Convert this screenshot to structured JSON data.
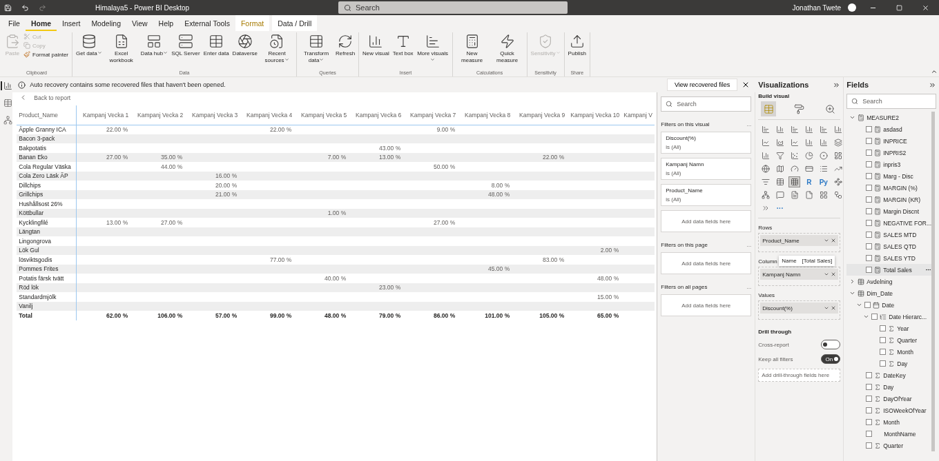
{
  "window": {
    "title": "Himalaya5 - Power BI Desktop",
    "search_placeholder": "Search",
    "user": "Jonathan Twete"
  },
  "ribbon_tabs": [
    {
      "label": "File",
      "kind": "plain",
      "selected": false
    },
    {
      "label": "Home",
      "kind": "plain",
      "selected": true
    },
    {
      "label": "Insert",
      "kind": "plain",
      "selected": false
    },
    {
      "label": "Modeling",
      "kind": "plain",
      "selected": false
    },
    {
      "label": "View",
      "kind": "plain",
      "selected": false
    },
    {
      "label": "Help",
      "kind": "plain",
      "selected": false
    },
    {
      "label": "External Tools",
      "kind": "plain",
      "selected": false
    },
    {
      "label": "Format",
      "kind": "contextual",
      "selected": false
    },
    {
      "label": "Data / Drill",
      "kind": "contextual",
      "selected": false
    }
  ],
  "ribbon_groups": [
    {
      "label": "Clipboard",
      "buttons": [
        {
          "label": "Paste",
          "kind": "large",
          "disabled": true,
          "dropdown": false
        },
        {
          "label": "Cut",
          "kind": "small",
          "disabled": true,
          "dropdown": false
        },
        {
          "label": "Copy",
          "kind": "small",
          "disabled": true,
          "dropdown": false
        },
        {
          "label": "Format painter",
          "kind": "small",
          "disabled": false,
          "dropdown": false
        }
      ]
    },
    {
      "label": "Data",
      "buttons": [
        {
          "label": "Get data",
          "kind": "large",
          "disabled": false,
          "dropdown": true
        },
        {
          "label": "Excel workbook",
          "kind": "large",
          "disabled": false,
          "dropdown": false
        },
        {
          "label": "Data hub",
          "kind": "large",
          "disabled": false,
          "dropdown": true
        },
        {
          "label": "SQL Server",
          "kind": "large",
          "disabled": false,
          "dropdown": false
        },
        {
          "label": "Enter data",
          "kind": "large",
          "disabled": false,
          "dropdown": false
        },
        {
          "label": "Dataverse",
          "kind": "large",
          "disabled": false,
          "dropdown": false
        },
        {
          "label": "Recent sources",
          "kind": "large",
          "disabled": false,
          "dropdown": true
        }
      ]
    },
    {
      "label": "Queries",
      "buttons": [
        {
          "label": "Transform data",
          "kind": "large",
          "disabled": false,
          "dropdown": true
        },
        {
          "label": "Refresh",
          "kind": "large",
          "disabled": false,
          "dropdown": false
        }
      ]
    },
    {
      "label": "Insert",
      "buttons": [
        {
          "label": "New visual",
          "kind": "large",
          "disabled": false,
          "dropdown": false
        },
        {
          "label": "Text box",
          "kind": "large",
          "disabled": false,
          "dropdown": false
        },
        {
          "label": "More visuals",
          "kind": "large",
          "disabled": false,
          "dropdown": true
        }
      ]
    },
    {
      "label": "Calculations",
      "buttons": [
        {
          "label": "New measure",
          "kind": "large",
          "disabled": false,
          "dropdown": false
        },
        {
          "label": "Quick measure",
          "kind": "large",
          "disabled": false,
          "dropdown": false
        }
      ]
    },
    {
      "label": "Sensitivity",
      "buttons": [
        {
          "label": "Sensitivity",
          "kind": "large",
          "disabled": true,
          "dropdown": true
        }
      ]
    },
    {
      "label": "Share",
      "buttons": [
        {
          "label": "Publish",
          "kind": "large",
          "disabled": false,
          "dropdown": false
        }
      ]
    }
  ],
  "view_rail": [
    {
      "selected": true
    },
    {
      "selected": false
    },
    {
      "selected": false
    }
  ],
  "notification": {
    "message": "Auto recovery contains some recovered files that haven't been opened.",
    "button": "View recovered files"
  },
  "back_link": "Back to report",
  "matrix": {
    "row_header": "Product_Name",
    "columns": [
      "Kampanj Vecka 1",
      "Kampanj Vecka 2",
      "Kampanj Vecka 3",
      "Kampanj Vecka 4",
      "Kampanj Vecka 5",
      "Kampanj Vecka 6",
      "Kampanj Vecka 7",
      "Kampanj Vecka 8",
      "Kampanj Vecka 9",
      "Kampanj Vecka 10",
      "Kampanj V"
    ],
    "rows": [
      {
        "name": "Äpple Granny ICA",
        "cells": [
          "22.00 %",
          null,
          null,
          "22.00 %",
          null,
          null,
          "9.00 %",
          null,
          null,
          null,
          null
        ]
      },
      {
        "name": "Bacon 3-pack",
        "cells": [
          null,
          null,
          null,
          null,
          null,
          null,
          null,
          null,
          null,
          null,
          null
        ]
      },
      {
        "name": "Bakpotatis",
        "cells": [
          null,
          null,
          null,
          null,
          null,
          "43.00 %",
          null,
          null,
          null,
          null,
          null
        ]
      },
      {
        "name": "Banan Eko",
        "cells": [
          "27.00 %",
          "35.00 %",
          null,
          null,
          "7.00 %",
          "13.00 %",
          null,
          null,
          "22.00 %",
          null,
          null
        ]
      },
      {
        "name": "Cola Regular Väska",
        "cells": [
          null,
          "44.00 %",
          null,
          null,
          null,
          null,
          "50.00 %",
          null,
          null,
          null,
          null
        ]
      },
      {
        "name": "Cola Zero Läsk ÄP",
        "cells": [
          null,
          null,
          "16.00 %",
          null,
          null,
          null,
          null,
          null,
          null,
          null,
          null
        ]
      },
      {
        "name": "Dillchips",
        "cells": [
          null,
          null,
          "20.00 %",
          null,
          null,
          null,
          null,
          "8.00 %",
          null,
          null,
          null
        ]
      },
      {
        "name": "Grillchips",
        "cells": [
          null,
          null,
          "21.00 %",
          null,
          null,
          null,
          null,
          "48.00 %",
          null,
          null,
          null
        ]
      },
      {
        "name": "Hushållsost 26%",
        "cells": [
          null,
          null,
          null,
          null,
          null,
          null,
          null,
          null,
          null,
          null,
          null
        ]
      },
      {
        "name": "Köttbullar",
        "cells": [
          null,
          null,
          null,
          null,
          "1.00 %",
          null,
          null,
          null,
          null,
          null,
          null
        ]
      },
      {
        "name": "Kycklingfilé",
        "cells": [
          "13.00 %",
          "27.00 %",
          null,
          null,
          null,
          null,
          "27.00 %",
          null,
          null,
          null,
          null
        ]
      },
      {
        "name": "Längtan",
        "cells": [
          null,
          null,
          null,
          null,
          null,
          null,
          null,
          null,
          null,
          null,
          null
        ]
      },
      {
        "name": "Lingongrova",
        "cells": [
          null,
          null,
          null,
          null,
          null,
          null,
          null,
          null,
          null,
          null,
          null
        ]
      },
      {
        "name": "Lök Gul",
        "cells": [
          null,
          null,
          null,
          null,
          null,
          null,
          null,
          null,
          null,
          "2.00 %",
          null
        ]
      },
      {
        "name": "lösviktsgodis",
        "cells": [
          null,
          null,
          null,
          "77.00 %",
          null,
          null,
          null,
          null,
          "83.00 %",
          null,
          null
        ]
      },
      {
        "name": "Pommes Frites",
        "cells": [
          null,
          null,
          null,
          null,
          null,
          null,
          null,
          "45.00 %",
          null,
          null,
          null
        ]
      },
      {
        "name": "Potatis färsk tvätt",
        "cells": [
          null,
          null,
          null,
          null,
          "40.00 %",
          null,
          null,
          null,
          null,
          "48.00 %",
          null
        ]
      },
      {
        "name": "Röd lök",
        "cells": [
          null,
          null,
          null,
          null,
          null,
          "23.00 %",
          null,
          null,
          null,
          null,
          null
        ]
      },
      {
        "name": "Standardmjölk",
        "cells": [
          null,
          null,
          null,
          null,
          null,
          null,
          null,
          null,
          null,
          "15.00 %",
          null
        ]
      },
      {
        "name": "Vanilj",
        "cells": [
          null,
          null,
          null,
          null,
          null,
          null,
          null,
          null,
          null,
          null,
          null
        ]
      }
    ],
    "total": {
      "name": "Total",
      "cells": [
        "62.00 %",
        "106.00 %",
        "57.00 %",
        "99.00 %",
        "48.00 %",
        "79.00 %",
        "86.00 %",
        "101.00 %",
        "105.00 %",
        "65.00 %",
        null
      ]
    }
  },
  "filters": {
    "search_placeholder": "Search",
    "sections": [
      {
        "title": "Filters on this visual",
        "more": "...",
        "cards": [
          {
            "name": "Discount(%)",
            "state": "is (All)"
          },
          {
            "name": "Kampanj Namn",
            "state": "is (All)"
          },
          {
            "name": "Product_Name",
            "state": "is (All)"
          }
        ],
        "add": "Add data fields here"
      },
      {
        "title": "Filters on this page",
        "more": "...",
        "add": "Add data fields here"
      },
      {
        "title": "Filters on all pages",
        "more": "...",
        "add": "Add data fields here"
      }
    ]
  },
  "visualizations": {
    "title": "Visualizations",
    "subtitle": "Build visual",
    "tabs": [
      {
        "selected": true
      },
      {
        "selected": false
      },
      {
        "selected": false
      }
    ],
    "gallery": [
      {
        "kind": "icon",
        "selected": false
      },
      {
        "kind": "icon",
        "selected": false
      },
      {
        "kind": "icon",
        "selected": false
      },
      {
        "kind": "icon",
        "selected": false
      },
      {
        "kind": "icon",
        "selected": false
      },
      {
        "kind": "icon",
        "selected": false
      },
      {
        "kind": "icon",
        "selected": false
      },
      {
        "kind": "icon",
        "selected": false
      },
      {
        "kind": "icon",
        "selected": false
      },
      {
        "kind": "icon",
        "selected": false
      },
      {
        "kind": "icon",
        "selected": false
      },
      {
        "kind": "icon",
        "selected": false
      },
      {
        "kind": "icon",
        "selected": false
      },
      {
        "kind": "icon",
        "selected": false
      },
      {
        "kind": "icon",
        "selected": false
      },
      {
        "kind": "icon",
        "selected": false
      },
      {
        "kind": "icon",
        "selected": false
      },
      {
        "kind": "icon",
        "selected": false
      },
      {
        "kind": "icon",
        "selected": false
      },
      {
        "kind": "icon",
        "selected": false
      },
      {
        "kind": "icon",
        "selected": false
      },
      {
        "kind": "icon",
        "selected": false
      },
      {
        "kind": "icon",
        "selected": false
      },
      {
        "kind": "icon",
        "selected": false
      },
      {
        "kind": "icon",
        "selected": false
      },
      {
        "kind": "icon",
        "selected": false
      },
      {
        "kind": "icon",
        "selected": true
      },
      {
        "kind": "text",
        "label": "R",
        "selected": false
      },
      {
        "kind": "text",
        "label": "Py",
        "selected": false
      },
      {
        "kind": "icon",
        "selected": false
      },
      {
        "kind": "icon",
        "selected": false
      },
      {
        "kind": "icon",
        "selected": false
      },
      {
        "kind": "icon",
        "selected": false
      },
      {
        "kind": "icon",
        "selected": false
      },
      {
        "kind": "icon",
        "selected": false
      },
      {
        "kind": "icon",
        "selected": false
      },
      {
        "kind": "icon",
        "selected": false
      },
      {
        "kind": "text",
        "label": "···",
        "selected": false
      }
    ],
    "wells": [
      {
        "label": "Rows",
        "field": "Product_Name"
      },
      {
        "label": "Column",
        "field": "Kampanj Namn"
      },
      {
        "label": "Values",
        "field": "Discount(%)"
      }
    ],
    "tooltip": {
      "name": "Name",
      "value": "[Total Sales]"
    },
    "drill_title": "Drill through",
    "toggles": [
      {
        "label": "Cross-report",
        "on": false
      },
      {
        "label": "Keep all filters",
        "on": true,
        "text": "On"
      }
    ],
    "drill_add": "Add drill-through fields here"
  },
  "fields": {
    "title": "Fields",
    "search_placeholder": "Search",
    "tree": [
      {
        "label": "MEASURE2",
        "kind": "measure-table",
        "expanded": true,
        "children": [
          {
            "label": "asdasd",
            "kind": "measure",
            "checked": false
          },
          {
            "label": "INPRICE",
            "kind": "measure",
            "checked": false
          },
          {
            "label": "INPRIS2",
            "kind": "measure",
            "checked": false
          },
          {
            "label": "inpris3",
            "kind": "measure",
            "checked": false
          },
          {
            "label": "Marg - Disc",
            "kind": "measure",
            "checked": false
          },
          {
            "label": "MARGIN (%)",
            "kind": "measure",
            "checked": false
          },
          {
            "label": "MARGIN (KR)",
            "kind": "measure",
            "checked": false
          },
          {
            "label": "Margin Discnt",
            "kind": "measure",
            "checked": false
          },
          {
            "label": "NEGATIVE FOR...",
            "kind": "measure",
            "checked": false
          },
          {
            "label": "SALES MTD",
            "kind": "measure",
            "checked": false
          },
          {
            "label": "SALES QTD",
            "kind": "measure",
            "checked": false
          },
          {
            "label": "SALES YTD",
            "kind": "measure",
            "checked": false
          },
          {
            "label": "Total Sales",
            "kind": "measure",
            "checked": false,
            "hovered": true
          }
        ]
      },
      {
        "label": "Avdelning",
        "kind": "table",
        "expanded": false
      },
      {
        "label": "Dim_Date",
        "kind": "table",
        "expanded": true,
        "children": [
          {
            "label": "Date",
            "kind": "date",
            "checked": false,
            "expanded": true,
            "children": [
              {
                "label": "Date Hierarc...",
                "kind": "hierarchy",
                "checked": false,
                "expanded": true,
                "children": [
                  {
                    "label": "Year",
                    "kind": "sum",
                    "checked": false
                  },
                  {
                    "label": "Quarter",
                    "kind": "sum",
                    "checked": false
                  },
                  {
                    "label": "Month",
                    "kind": "sum",
                    "checked": false
                  },
                  {
                    "label": "Day",
                    "kind": "sum",
                    "checked": false
                  }
                ]
              }
            ]
          },
          {
            "label": "DateKey",
            "kind": "sum",
            "checked": false
          },
          {
            "label": "Day",
            "kind": "sum",
            "checked": false
          },
          {
            "label": "DayOfYear",
            "kind": "sum",
            "checked": false
          },
          {
            "label": "ISOWeekOfYear",
            "kind": "sum",
            "checked": false
          },
          {
            "label": "Month",
            "kind": "sum",
            "checked": false
          },
          {
            "label": "MonthName",
            "kind": "text",
            "checked": false
          },
          {
            "label": "Quarter",
            "kind": "sum",
            "checked": false
          }
        ]
      }
    ]
  }
}
